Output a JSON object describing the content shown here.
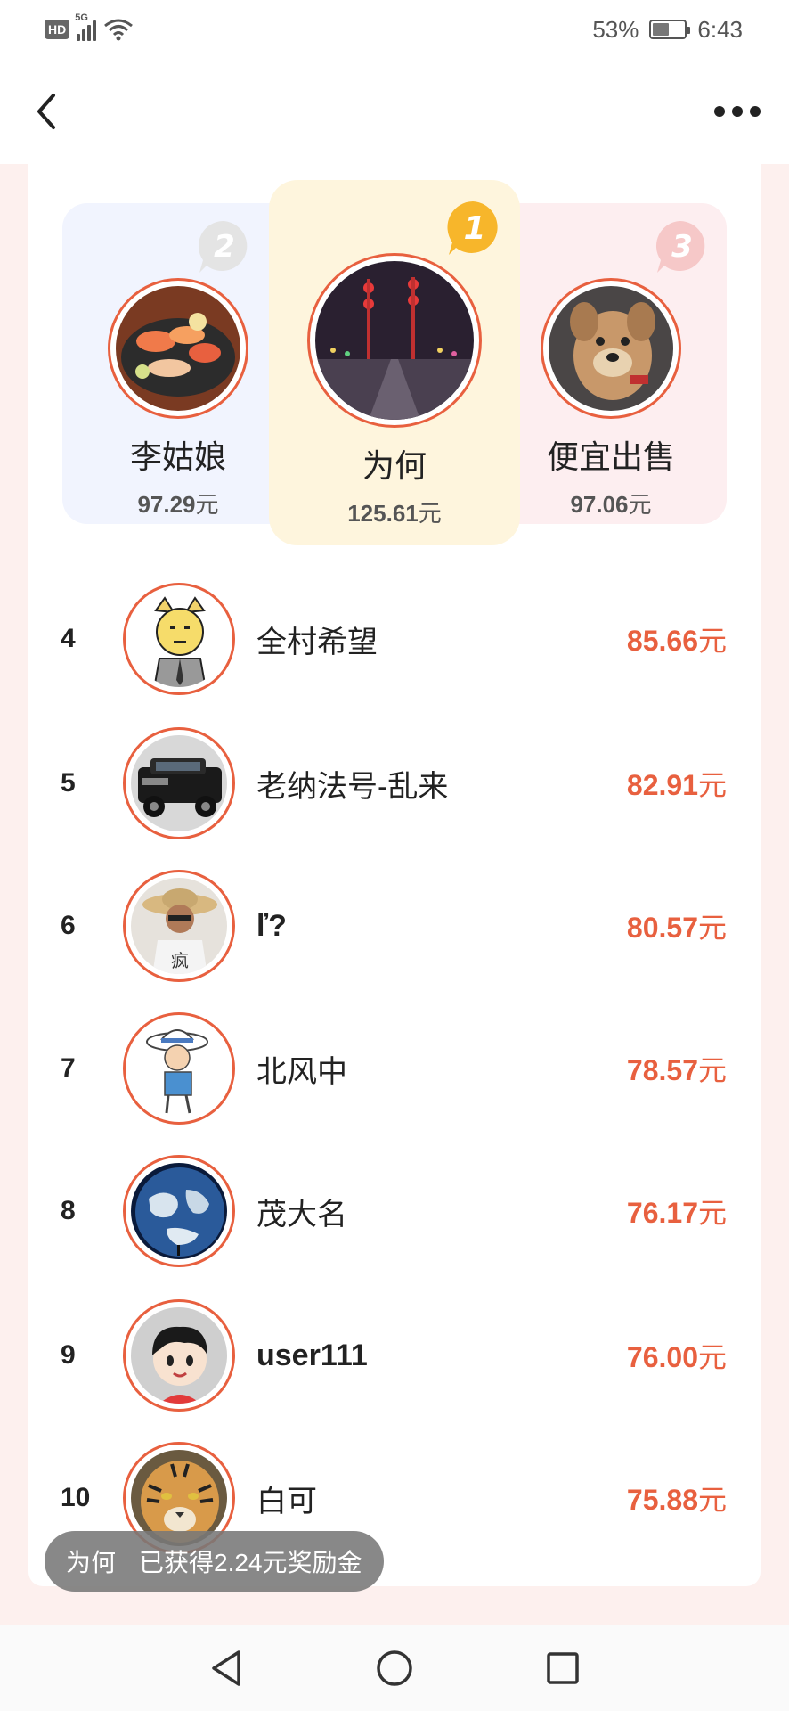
{
  "status_bar": {
    "network_label": "HD",
    "signal_label": "5G",
    "battery_percent": "53%",
    "battery_level": 0.53,
    "time": "6:43"
  },
  "nav": {
    "back_icon": "chevron-left-icon",
    "more_icon": "more-horizontal-icon"
  },
  "podium": [
    {
      "rank": "1",
      "name": "为何",
      "amount": "125.61",
      "unit": "元",
      "avatar": "night-street-lights",
      "badge_color": "#f7b62b"
    },
    {
      "rank": "2",
      "name": "李姑娘",
      "amount": "97.29",
      "unit": "元",
      "avatar": "sushi-platter",
      "badge_color": "#e3e3e3"
    },
    {
      "rank": "3",
      "name": "便宜出售",
      "amount": "97.06",
      "unit": "元",
      "avatar": "plush-dog",
      "badge_color": "#f6c8c8"
    }
  ],
  "ranking": [
    {
      "rank": "4",
      "name": "全村希望",
      "amount": "85.66",
      "unit": "元",
      "avatar": "cartoon-meme-face"
    },
    {
      "rank": "5",
      "name": "老纳法号-乱来",
      "amount": "82.91",
      "unit": "元",
      "avatar": "black-suv"
    },
    {
      "rank": "6",
      "name": "ľ?",
      "amount": "80.57",
      "unit": "元",
      "avatar": "man-straw-hat"
    },
    {
      "rank": "7",
      "name": "北风中",
      "amount": "78.57",
      "unit": "元",
      "avatar": "cartoon-hat-boy"
    },
    {
      "rank": "8",
      "name": "茂大名",
      "amount": "76.17",
      "unit": "元",
      "avatar": "earth-globe"
    },
    {
      "rank": "9",
      "name": "user111",
      "amount": "76.00",
      "unit": "元",
      "avatar": "cartoon-default-boy"
    },
    {
      "rank": "10",
      "name": "白可",
      "amount": "75.88",
      "unit": "元",
      "avatar": "tiger"
    }
  ],
  "toast": {
    "user": "为何",
    "message": "已获得2.24元奖励金"
  },
  "system_nav": {
    "back_icon": "triangle-back-icon",
    "home_icon": "circle-home-icon",
    "recents_icon": "square-recents-icon"
  },
  "colors": {
    "accent": "#e8603f",
    "page_bg": "#fdf0ee",
    "gold_bg": "#fef5dd",
    "silver_bg": "#f1f4fe",
    "bronze_bg": "#fdeef0"
  }
}
